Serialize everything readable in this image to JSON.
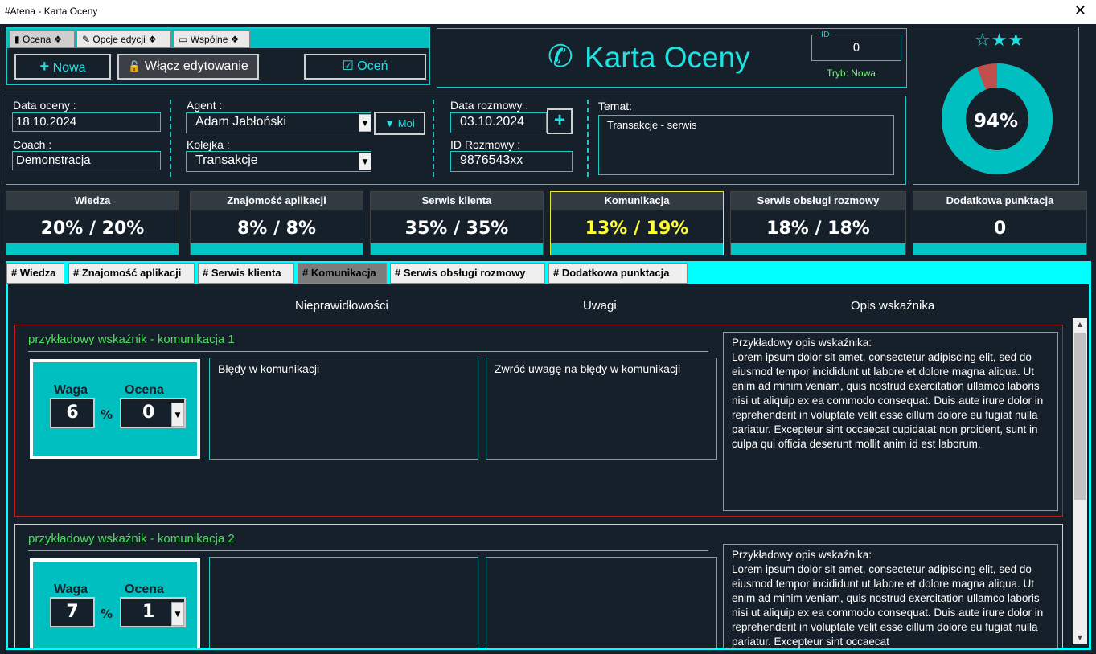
{
  "window": {
    "title": "#Atena - Karta Oceny",
    "close": "✕"
  },
  "toolbar": {
    "tabs": [
      {
        "label": "Ocena ❖",
        "icon": "▮"
      },
      {
        "label": "Opcje edycji ❖",
        "icon": "✎"
      },
      {
        "label": "Wspólne ❖",
        "icon": "▭"
      }
    ],
    "new_label": "Nowa",
    "new_icon": "+",
    "edit_label": "Włącz edytowanie",
    "edit_icon": "🔓",
    "rate_label": "Oceń",
    "rate_icon": "☑"
  },
  "header": {
    "title": "Karta Oceny",
    "phone_icon": "✆",
    "id_label": "ID",
    "id_value": "0",
    "mode": "Tryb: Nowa"
  },
  "score": {
    "stars": "☆★★",
    "percent": "94%",
    "fraction": 0.94,
    "ring_color": "#00bfc0",
    "rest_color": "#c0504d"
  },
  "form": {
    "date_label": "Data oceny :",
    "date_value": "18.10.2024",
    "coach_label": "Coach :",
    "coach_value": "Demonstracja",
    "agent_label": "Agent :",
    "agent_value": "Adam Jabłoński",
    "moi_label": "▼ Moi",
    "queue_label": "Kolejka :",
    "queue_value": "Transakcje",
    "call_date_label": "Data rozmowy :",
    "call_date_value": "03.10.2024",
    "call_id_label": "ID Rozmowy :",
    "call_id_value": "9876543xx",
    "plus": "+",
    "topic_label": "Temat:",
    "topic_value": "Transakcje - serwis"
  },
  "cards": [
    {
      "title": "Wiedza",
      "value": "20%  /  20%",
      "color": "#ffffff"
    },
    {
      "title": "Znajomość aplikacji",
      "value": "8%  /  8%",
      "color": "#ffffff"
    },
    {
      "title": "Serwis klienta",
      "value": "35%  /  35%",
      "color": "#ffffff"
    },
    {
      "title": "Komunikacja",
      "value": "13%  /  19%",
      "color": "#ffff33"
    },
    {
      "title": "Serwis obsługi rozmowy",
      "value": "18%  /  18%",
      "color": "#ffffff"
    },
    {
      "title": "Dodatkowa punktacja",
      "value": "0",
      "color": "#ffffff"
    }
  ],
  "section_tabs": [
    "# Wiedza",
    "# Znajomość aplikacji",
    "# Serwis klienta",
    "# Komunikacja",
    "# Serwis obsługi rozmowy",
    "# Dodatkowa punktacja"
  ],
  "columns": {
    "issues": "Nieprawidłowości",
    "notes": "Uwagi",
    "desc": "Opis wskaźnika"
  },
  "indicators": [
    {
      "title": "przykładowy wskaźnik - komunikacja 1",
      "waga_label": "Waga",
      "ocena_label": "Ocena",
      "weight": "6",
      "pct": "%",
      "score": "0",
      "issues": "Błędy w komunikacji",
      "notes": "Zwróć uwagę na błędy w komunikacji",
      "desc": "Przykładowy opis wskaźnika:\nLorem ipsum dolor sit amet, consectetur adipiscing elit, sed do eiusmod tempor incididunt ut labore et dolore magna aliqua. Ut enim ad minim veniam, quis nostrud exercitation ullamco laboris nisi ut aliquip ex ea commodo consequat. Duis aute irure dolor in reprehenderit in voluptate velit esse cillum dolore eu fugiat nulla pariatur. Excepteur sint occaecat cupidatat non proident, sunt in culpa qui officia deserunt mollit anim id est laborum."
    },
    {
      "title": "przykładowy wskaźnik - komunikacja 2",
      "waga_label": "Waga",
      "ocena_label": "Ocena",
      "weight": "7",
      "pct": "%",
      "score": "1",
      "issues": "",
      "notes": "",
      "desc": "Przykładowy opis wskaźnika:\nLorem ipsum dolor sit amet, consectetur adipiscing elit, sed do eiusmod tempor incididunt ut labore et dolore magna aliqua. Ut enim ad minim veniam, quis nostrud exercitation ullamco laboris nisi ut aliquip ex ea commodo consequat. Duis aute irure dolor in reprehenderit in voluptate velit esse cillum dolore eu fugiat nulla pariatur. Excepteur sint occaecat"
    }
  ]
}
